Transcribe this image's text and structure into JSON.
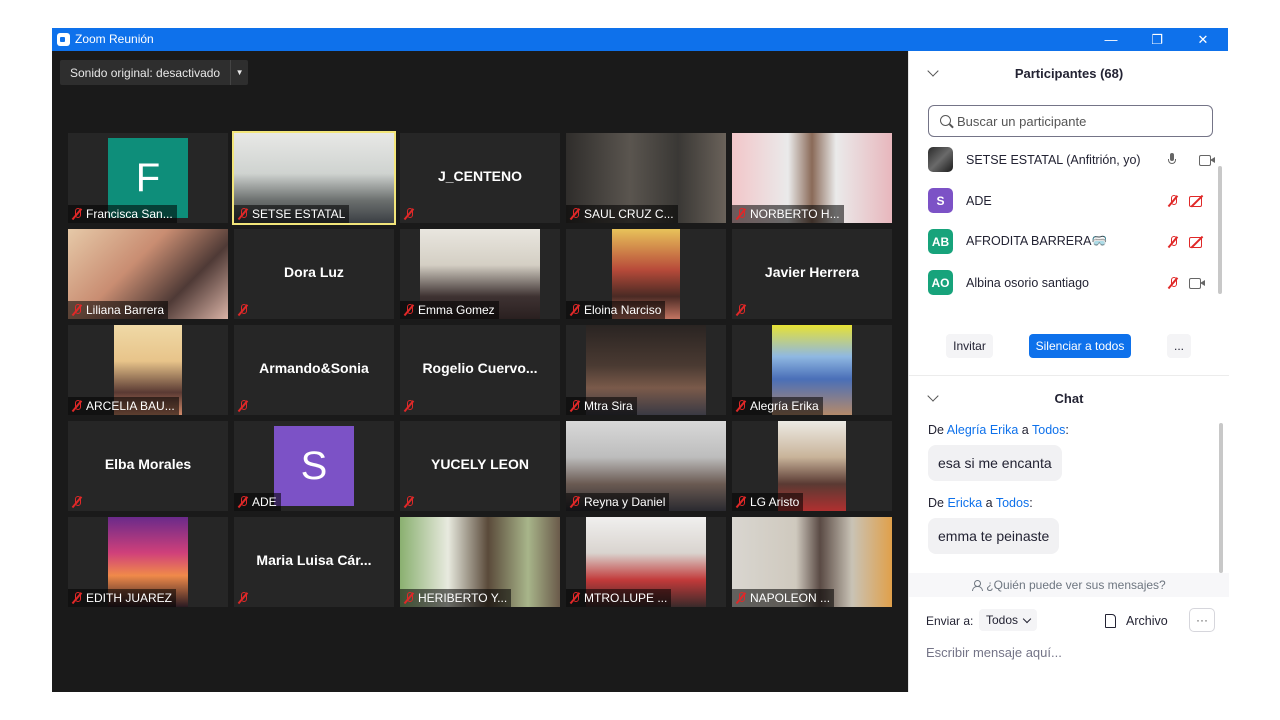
{
  "window": {
    "title": "Zoom Reunión",
    "minimize": "—",
    "restore": "❐",
    "close": "✕"
  },
  "toolbar": {
    "sound_label": "Sonido original: desactivado"
  },
  "tiles": [
    {
      "kind": "avatar",
      "label": "Francisca San...",
      "letter": "F",
      "color": "#0e8e7a"
    },
    {
      "kind": "photo",
      "label": "SETSE ESTATAL",
      "active": true
    },
    {
      "kind": "name",
      "center": "J_CENTENO"
    },
    {
      "kind": "photo",
      "label": "SAUL CRUZ C..."
    },
    {
      "kind": "photo",
      "label": "NORBERTO H..."
    },
    {
      "kind": "photo",
      "label": "Liliana Barrera"
    },
    {
      "kind": "name",
      "center": "Dora Luz"
    },
    {
      "kind": "photo",
      "label": "Emma Gomez"
    },
    {
      "kind": "photo",
      "label": "Eloina Narciso"
    },
    {
      "kind": "name",
      "center": "Javier Herrera"
    },
    {
      "kind": "photo",
      "label": "ARCELIA BAU..."
    },
    {
      "kind": "name",
      "center": "Armando&Sonia"
    },
    {
      "kind": "name",
      "center": "Rogelio  Cuervo..."
    },
    {
      "kind": "photo",
      "label": "Mtra Sira"
    },
    {
      "kind": "photo",
      "label": "Alegría Erika"
    },
    {
      "kind": "name",
      "center": "Elba Morales"
    },
    {
      "kind": "avatar",
      "label": "ADE",
      "letter": "S",
      "color": "#7c52c6"
    },
    {
      "kind": "name",
      "center": "YUCELY LEON"
    },
    {
      "kind": "photo",
      "label": "Reyna y Daniel"
    },
    {
      "kind": "photo",
      "label": "LG Aristo"
    },
    {
      "kind": "photo",
      "label": "EDITH JUAREZ"
    },
    {
      "kind": "name",
      "center": "Maria  Luisa  Cár..."
    },
    {
      "kind": "photo",
      "label": "HERIBERTO Y..."
    },
    {
      "kind": "photo",
      "label": "MTRO.LUPE  ..."
    },
    {
      "kind": "photo",
      "label": "NAPOLEON ..."
    }
  ],
  "participants": {
    "header": "Participantes (68)",
    "search_placeholder": "Buscar un participante",
    "items": [
      {
        "name": "SETSE ESTATAL (Anfitrión, yo)",
        "avatar_text": "",
        "avatar_color": "#3a3a3a",
        "mic": "on",
        "cam": "on"
      },
      {
        "name": "ADE",
        "avatar_text": "S",
        "avatar_color": "#7c52c6",
        "mic": "off",
        "cam": "off"
      },
      {
        "name": "AFRODITA  BARRERA🥽",
        "avatar_text": "AB",
        "avatar_color": "#17a37b",
        "mic": "off",
        "cam": "off"
      },
      {
        "name": "Albina osorio santiago",
        "avatar_text": "AO",
        "avatar_color": "#17a37b",
        "mic": "off",
        "cam": "on"
      }
    ],
    "invite_label": "Invitar",
    "mute_all_label": "Silenciar a todos",
    "more_label": "..."
  },
  "chat": {
    "header": "Chat",
    "messages": [
      {
        "prefix": "De ",
        "from": "Alegría Erika",
        "mid": " a ",
        "to": "Todos",
        "suffix": ":",
        "text": "esa si me encanta"
      },
      {
        "prefix": "De ",
        "from": "Ericka",
        "mid": " a ",
        "to": "Todos",
        "suffix": ":",
        "text": "emma te peinaste"
      }
    ],
    "who_can_see": "¿Quién puede ver sus mensajes?",
    "send_to_label": "Enviar a:",
    "send_to_value": "Todos",
    "file_label": "Archivo",
    "more_label": "···",
    "input_placeholder": "Escribir mensaje aquí..."
  }
}
